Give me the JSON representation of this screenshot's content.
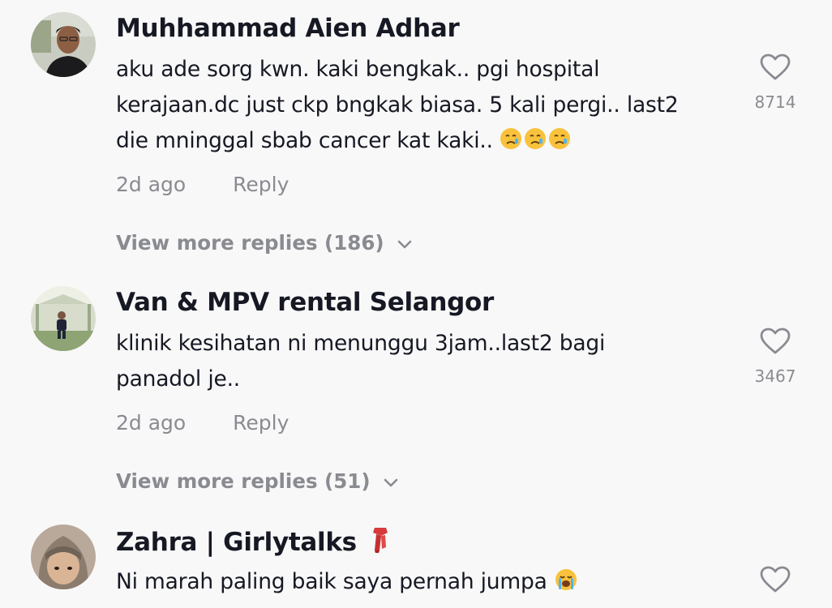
{
  "comments": [
    {
      "username": "Muhhammad Aien Adhar",
      "text_line1": "aku ade sorg kwn. kaki bengkak.. pgi hospital",
      "text_line2": "kerajaan.dc just ckp bngkak biasa. 5 kali pergi.. last2",
      "text_line3": "die mninggal sbab cancer kat kaki..",
      "emoji": "crying-face x3",
      "time": "2d ago",
      "reply_label": "Reply",
      "view_more": "View more replies (186)",
      "likes": "8714"
    },
    {
      "username": "Van & MPV rental Selangor",
      "text_line1": "klinik kesihatan ni menunggu 3jam..last2 bagi",
      "text_line2": "panadol je..",
      "time": "2d ago",
      "reply_label": "Reply",
      "view_more": "View more replies (51)",
      "likes": "3467"
    },
    {
      "username": "Zahra | Girlytalks",
      "username_emoji": "scarf-icon",
      "text_line1": "Ni marah paling baik saya pernah jumpa",
      "emoji": "loudly-crying-face"
    }
  ],
  "colors": {
    "background": "#f8f8f8",
    "primary_text": "#161823",
    "secondary_text": "#8a8b91"
  }
}
